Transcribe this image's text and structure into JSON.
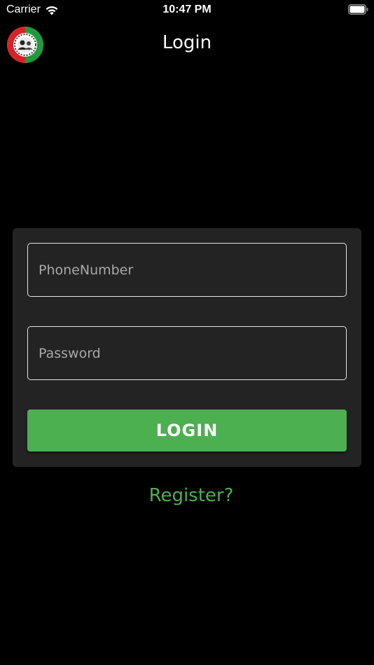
{
  "status_bar": {
    "carrier": "Carrier",
    "time": "10:47 PM",
    "icons": [
      "wifi-icon",
      "battery-icon"
    ]
  },
  "nav": {
    "title": "Login",
    "logo_icon": "app-logo-icon"
  },
  "form": {
    "phone_placeholder": "PhoneNumber",
    "phone_value": "",
    "password_placeholder": "Password",
    "password_value": "",
    "login_label": "LOGIN"
  },
  "register": {
    "label": "Register?"
  },
  "colors": {
    "background": "#000000",
    "card": "#232323",
    "accent": "#4caf50",
    "field_border": "#e6e6e6",
    "placeholder": "#a8a8a8"
  }
}
